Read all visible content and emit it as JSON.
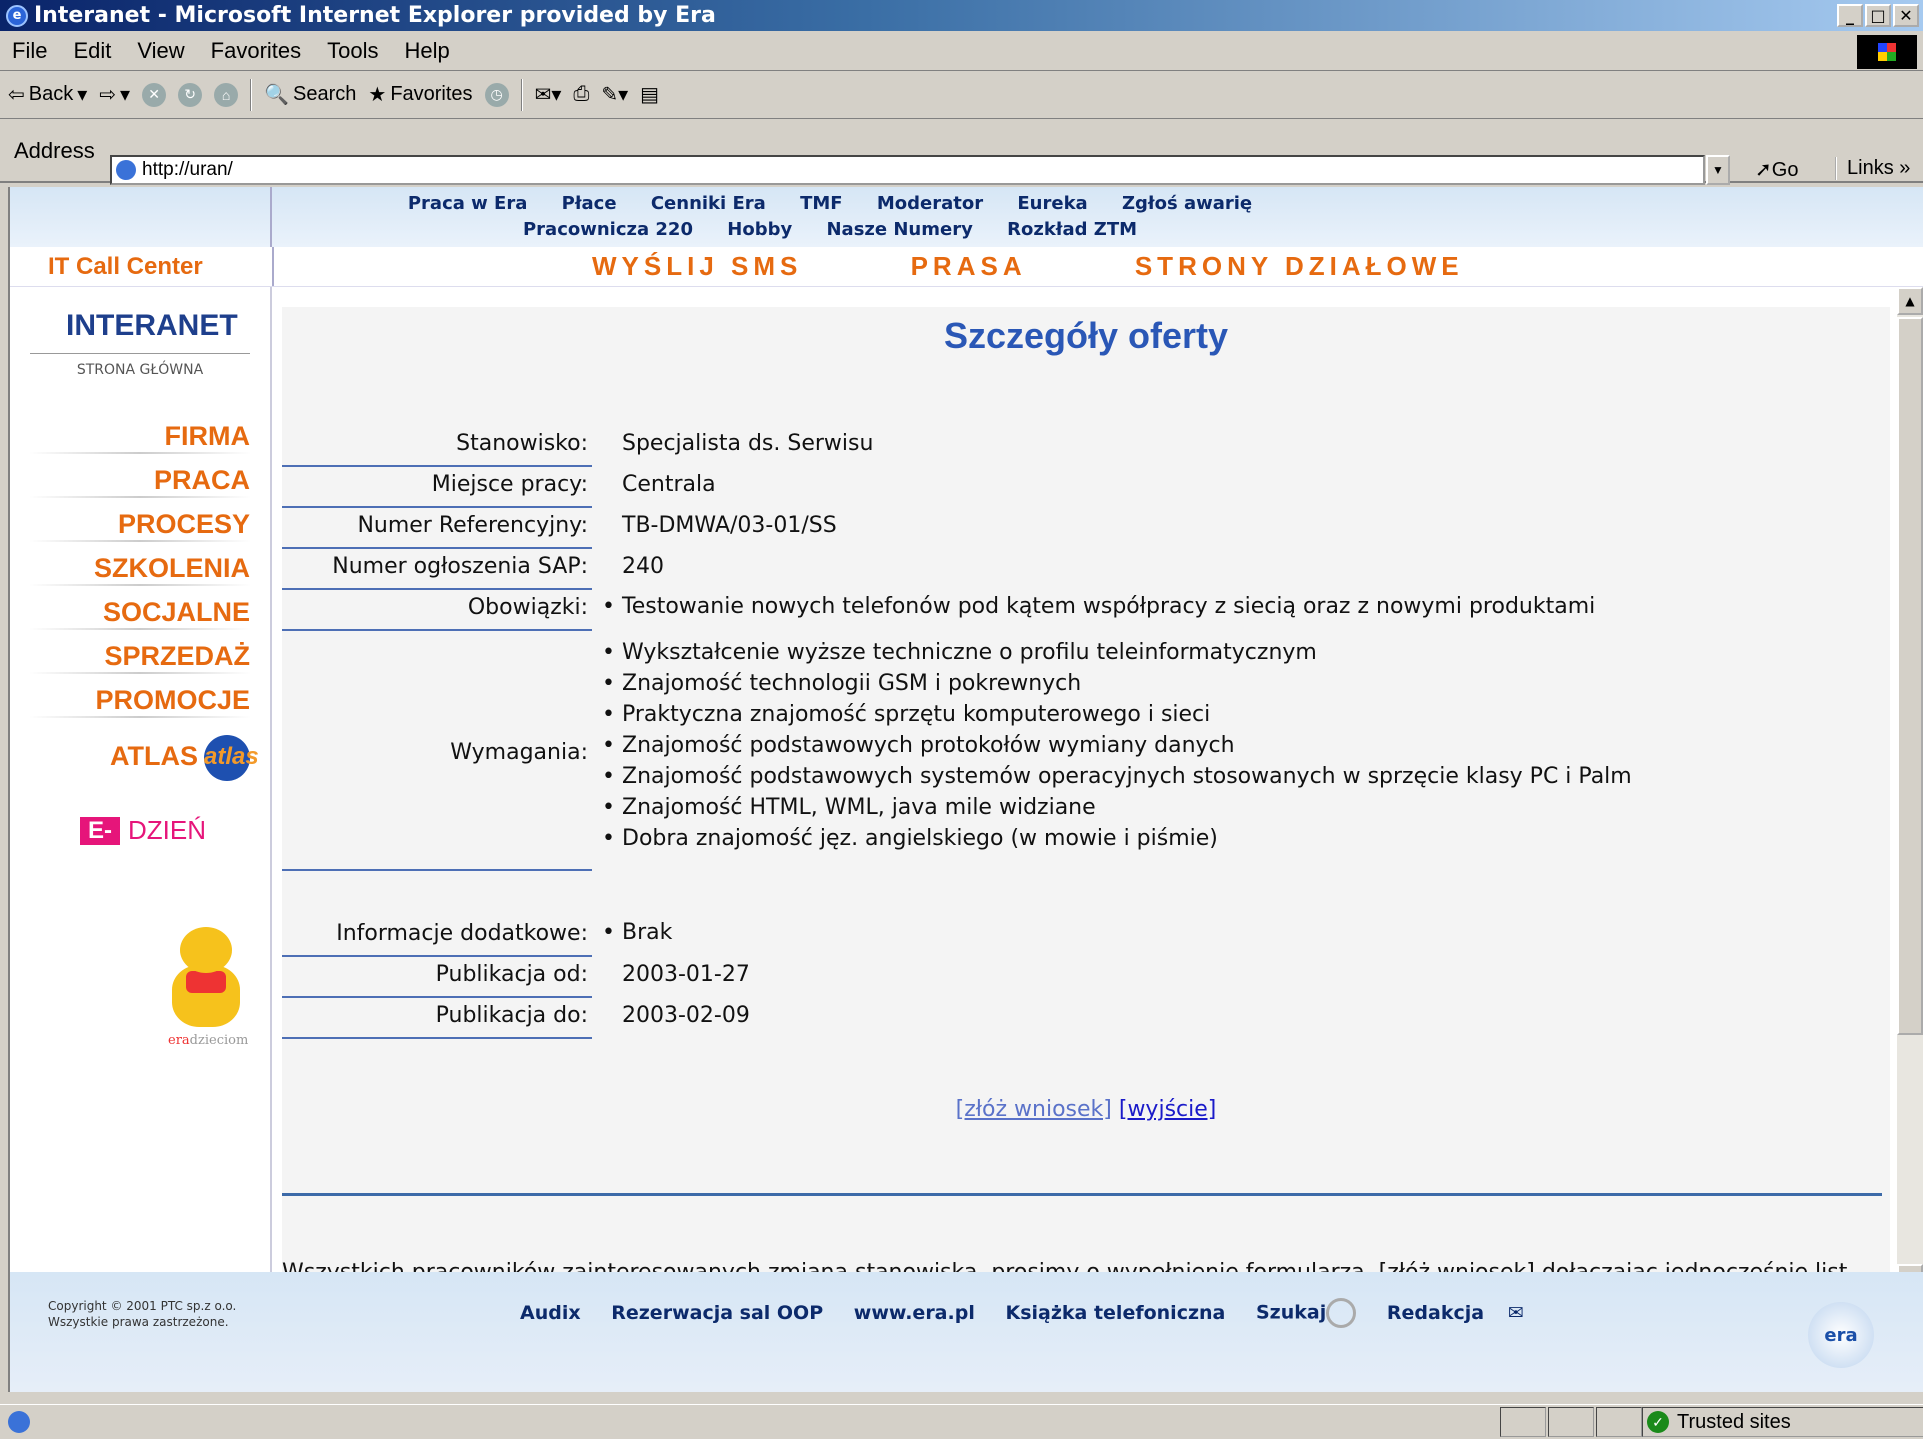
{
  "window": {
    "title": "Interanet - Microsoft Internet Explorer provided by Era",
    "btn_min": "_",
    "btn_max": "□",
    "btn_close": "✕"
  },
  "menu": [
    "File",
    "Edit",
    "View",
    "Favorites",
    "Tools",
    "Help"
  ],
  "toolbar": {
    "back": "Back",
    "search": "Search",
    "favorites": "Favorites"
  },
  "address": {
    "label": "Address",
    "url": "http://uran/",
    "go": "Go",
    "links": "Links »"
  },
  "topnav": {
    "row1": [
      "Praca w Era",
      "Płace",
      "Cenniki Era",
      "TMF",
      "Moderator",
      "Eureka",
      "Zgłoś awarię"
    ],
    "row2": [
      "Pracownicza 220",
      "Hobby",
      "Nasze Numery",
      "Rozkład ZTM"
    ]
  },
  "subnav": {
    "it_call_center": "IT Call Center",
    "links": [
      "WYŚLIJ SMS",
      "PRASA",
      "STRONY DZIAŁOWE"
    ]
  },
  "sidebar": {
    "title": "INTERANET",
    "subtitle": "STRONA GŁÓWNA",
    "items": [
      "FIRMA",
      "PRACA",
      "PROCESY",
      "SZKOLENIA",
      "SOCJALNE",
      "SPRZEDAŻ",
      "PROMOCJE",
      "ATLAS"
    ],
    "atlas_logo": "atlas",
    "edzien_e": "E-",
    "edzien_d": "DZIEŃ",
    "teddy_caption_a": "era",
    "teddy_caption_b": "dzieciom"
  },
  "offer": {
    "heading": "Szczegóły oferty",
    "fields": [
      {
        "label": "Stanowisko:",
        "value": "Specjalista ds. Serwisu"
      },
      {
        "label": "Miejsce pracy:",
        "value": "Centrala"
      },
      {
        "label": "Numer Referencyjny:",
        "value": "TB-DMWA/03-01/SS"
      },
      {
        "label": "Numer ogłoszenia SAP:",
        "value": "240"
      }
    ],
    "obowiazki_label": "Obowiązki:",
    "obowiazki": [
      "Testowanie nowych telefonów pod kątem współpracy z siecią oraz z nowymi produktami"
    ],
    "wymagania_label": "Wymagania:",
    "wymagania": [
      "Wykształcenie wyższe techniczne o profilu teleinformatycznym",
      "Znajomość technologii GSM i pokrewnych",
      "Praktyczna znajomość sprzętu komputerowego i sieci",
      "Znajomość podstawowych protokołów wymiany danych",
      "Znajomość podstawowych systemów operacyjnych stosowanych w sprzęcie klasy PC i Palm",
      "Znajomość HTML, WML, java mile widziane",
      "Dobra znajomość jęz. angielskiego (w mowie i piśmie)"
    ],
    "info_label": "Informacje dodatkowe:",
    "info": [
      "Brak"
    ],
    "pub_od_label": "Publikacja od:",
    "pub_od": "2003-01-27",
    "pub_do_label": "Publikacja do:",
    "pub_do": "2003-02-09",
    "apply_link": "[złóż wniosek]",
    "exit_link": "[wyjście]",
    "note": "Wszystkich pracowników zainteresowanych zmianą stanowiska, prosimy o wypełnienie formularza, [złóż wniosek] dołączając jednocześnie list motywacyjny ze zdjęciem oraz CV  w języku polskim i angielskim z zaznaczeniem numeru referencyjnego"
  },
  "footer": {
    "copyright_1": "Copyright © 2001 PTC sp.z o.o.",
    "copyright_2": "Wszystkie prawa zastrzeżone.",
    "links": [
      "Audix",
      "Rezerwacja sal OOP",
      "www.era.pl",
      "Książka telefoniczna",
      "Szukaj",
      "Redakcja"
    ],
    "era_logo": "era"
  },
  "status": {
    "zone": "Trusted sites"
  }
}
